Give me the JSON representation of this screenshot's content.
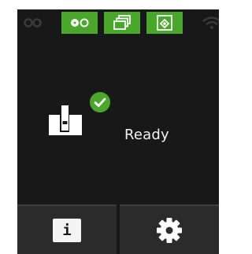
{
  "colors": {
    "screen_bg": "#181818",
    "accent_green": "#49a829",
    "button_bg": "#2b2b2b",
    "icon_dim": "#3a3a3a",
    "text": "#f2f2f2"
  },
  "status_bar": {
    "items": [
      {
        "icon": "ribbon-icon",
        "active": false
      },
      {
        "icon": "tape-reel-icon",
        "active": true
      },
      {
        "icon": "cards-stack-icon",
        "active": true
      },
      {
        "icon": "card-hopper-icon",
        "active": true
      },
      {
        "icon": "wifi-icon",
        "active": false
      }
    ]
  },
  "status": {
    "icon": "printer-card-icon",
    "badge": "checkmark-icon",
    "text": "Ready"
  },
  "buttons": {
    "info_glyph": "i",
    "info_icon": "info-icon",
    "settings_icon": "gear-icon"
  }
}
